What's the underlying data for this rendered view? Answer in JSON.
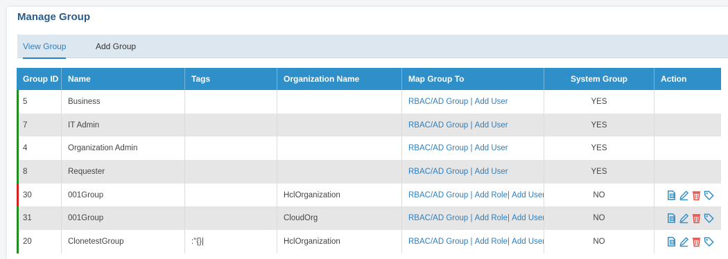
{
  "page": {
    "title": "Manage Group"
  },
  "tabs": [
    {
      "label": "View Group",
      "active": true
    },
    {
      "label": "Add Group",
      "active": false
    }
  ],
  "table": {
    "headers": [
      "Group ID",
      "Name",
      "Tags",
      "Organization Name",
      "Map Group To",
      "System Group",
      "Action"
    ],
    "rows": [
      {
        "id": "5",
        "name": "Business",
        "tags": "",
        "org": "",
        "map": [
          "RBAC/AD Group",
          " | ",
          "Add User"
        ],
        "system": "YES",
        "actions": false,
        "status": "green"
      },
      {
        "id": "7",
        "name": "IT Admin",
        "tags": "",
        "org": "",
        "map": [
          "RBAC/AD Group",
          " | ",
          "Add User"
        ],
        "system": "YES",
        "actions": false,
        "status": "green"
      },
      {
        "id": "4",
        "name": "Organization Admin",
        "tags": "",
        "org": "",
        "map": [
          "RBAC/AD Group",
          " | ",
          "Add User"
        ],
        "system": "YES",
        "actions": false,
        "status": "green"
      },
      {
        "id": "8",
        "name": "Requester",
        "tags": "",
        "org": "",
        "map": [
          "RBAC/AD Group",
          " | ",
          "Add User"
        ],
        "system": "YES",
        "actions": false,
        "status": "green"
      },
      {
        "id": "30",
        "name": "001Group",
        "tags": "",
        "org": "HclOrganization",
        "map": [
          "RBAC/AD Group",
          " | ",
          "Add Role",
          "| ",
          "Add User"
        ],
        "system": "NO",
        "actions": true,
        "status": "red"
      },
      {
        "id": "31",
        "name": "001Group",
        "tags": "",
        "org": "CloudOrg",
        "map": [
          "RBAC/AD Group",
          " | ",
          "Add Role",
          "| ",
          "Add User"
        ],
        "system": "NO",
        "actions": true,
        "status": "green"
      },
      {
        "id": "20",
        "name": "ClonetestGroup",
        "tags": ":\"{}|",
        "org": "HclOrganization",
        "map": [
          "RBAC/AD Group",
          " | ",
          "Add Role",
          "| ",
          "Add User"
        ],
        "system": "NO",
        "actions": true,
        "status": "green"
      }
    ]
  },
  "colors": {
    "header": "#2f8fc9",
    "link": "#2a7fc1",
    "status_green": "#1e8e1e",
    "status_red": "#d42020",
    "icon_blue": "#2f8fc9",
    "icon_red": "#e0483f"
  },
  "icons": {
    "action": [
      "clone-doc-icon",
      "edit-pencil-icon",
      "delete-trash-icon",
      "tag-icon"
    ]
  }
}
